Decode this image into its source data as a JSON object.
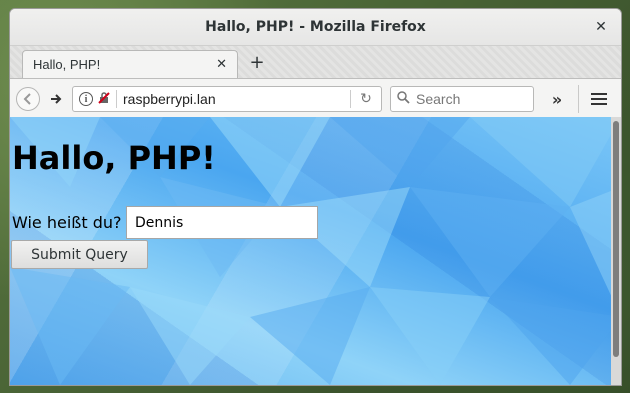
{
  "window": {
    "title": "Hallo, PHP! - Mozilla Firefox"
  },
  "tabs": [
    {
      "label": "Hallo, PHP!"
    }
  ],
  "navbar": {
    "url": "raspberrypi.lan",
    "search_placeholder": "Search"
  },
  "icons": {
    "close": "close-icon",
    "tab_close": "close-icon",
    "new_tab": "plus-icon",
    "back": "back-arrow-icon",
    "forward": "forward-arrow-icon",
    "info": "info-icon",
    "insecure": "insecure-connection-icon",
    "reload": "reload-icon",
    "search": "search-icon",
    "overflow": "overflow-chevron-icon",
    "menu": "hamburger-menu-icon"
  },
  "page": {
    "heading": "Hallo, PHP!",
    "name_label": "Wie heißt du?",
    "name_value": "Dennis",
    "submit_label": "Submit Query"
  },
  "colors": {
    "content_bg": "#5fb3f1"
  }
}
